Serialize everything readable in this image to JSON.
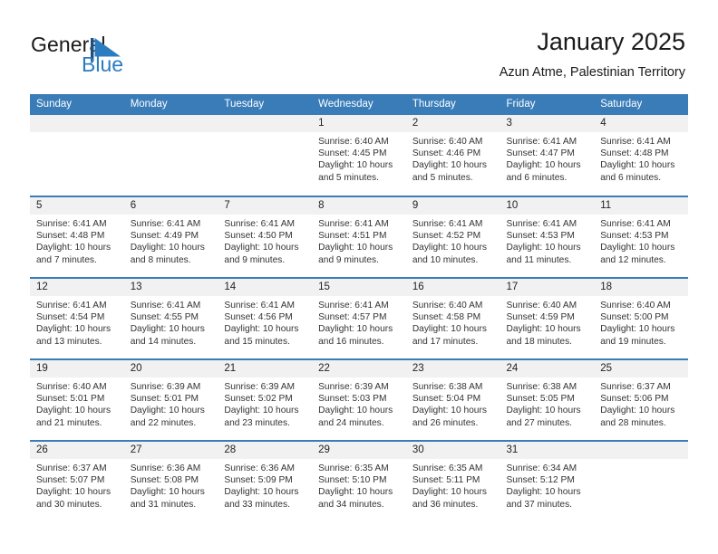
{
  "brand": {
    "name_part1": "General",
    "name_part2": "Blue",
    "logo_icon": "blue-triangle-flag-icon",
    "accent_color": "#2b7cc0"
  },
  "header": {
    "title": "January 2025",
    "subtitle": "Azun Atme, Palestinian Territory"
  },
  "theme": {
    "header_blue": "#3a7cb8",
    "band_gray": "#f1f1f1",
    "text_dark": "#1a1a1a"
  },
  "calendar": {
    "weekday_headers": [
      "Sunday",
      "Monday",
      "Tuesday",
      "Wednesday",
      "Thursday",
      "Friday",
      "Saturday"
    ],
    "weeks": [
      [
        {
          "day": "",
          "lines": []
        },
        {
          "day": "",
          "lines": []
        },
        {
          "day": "",
          "lines": []
        },
        {
          "day": "1",
          "lines": [
            "Sunrise: 6:40 AM",
            "Sunset: 4:45 PM",
            "Daylight: 10 hours",
            "and 5 minutes."
          ]
        },
        {
          "day": "2",
          "lines": [
            "Sunrise: 6:40 AM",
            "Sunset: 4:46 PM",
            "Daylight: 10 hours",
            "and 5 minutes."
          ]
        },
        {
          "day": "3",
          "lines": [
            "Sunrise: 6:41 AM",
            "Sunset: 4:47 PM",
            "Daylight: 10 hours",
            "and 6 minutes."
          ]
        },
        {
          "day": "4",
          "lines": [
            "Sunrise: 6:41 AM",
            "Sunset: 4:48 PM",
            "Daylight: 10 hours",
            "and 6 minutes."
          ]
        }
      ],
      [
        {
          "day": "5",
          "lines": [
            "Sunrise: 6:41 AM",
            "Sunset: 4:48 PM",
            "Daylight: 10 hours",
            "and 7 minutes."
          ]
        },
        {
          "day": "6",
          "lines": [
            "Sunrise: 6:41 AM",
            "Sunset: 4:49 PM",
            "Daylight: 10 hours",
            "and 8 minutes."
          ]
        },
        {
          "day": "7",
          "lines": [
            "Sunrise: 6:41 AM",
            "Sunset: 4:50 PM",
            "Daylight: 10 hours",
            "and 9 minutes."
          ]
        },
        {
          "day": "8",
          "lines": [
            "Sunrise: 6:41 AM",
            "Sunset: 4:51 PM",
            "Daylight: 10 hours",
            "and 9 minutes."
          ]
        },
        {
          "day": "9",
          "lines": [
            "Sunrise: 6:41 AM",
            "Sunset: 4:52 PM",
            "Daylight: 10 hours",
            "and 10 minutes."
          ]
        },
        {
          "day": "10",
          "lines": [
            "Sunrise: 6:41 AM",
            "Sunset: 4:53 PM",
            "Daylight: 10 hours",
            "and 11 minutes."
          ]
        },
        {
          "day": "11",
          "lines": [
            "Sunrise: 6:41 AM",
            "Sunset: 4:53 PM",
            "Daylight: 10 hours",
            "and 12 minutes."
          ]
        }
      ],
      [
        {
          "day": "12",
          "lines": [
            "Sunrise: 6:41 AM",
            "Sunset: 4:54 PM",
            "Daylight: 10 hours",
            "and 13 minutes."
          ]
        },
        {
          "day": "13",
          "lines": [
            "Sunrise: 6:41 AM",
            "Sunset: 4:55 PM",
            "Daylight: 10 hours",
            "and 14 minutes."
          ]
        },
        {
          "day": "14",
          "lines": [
            "Sunrise: 6:41 AM",
            "Sunset: 4:56 PM",
            "Daylight: 10 hours",
            "and 15 minutes."
          ]
        },
        {
          "day": "15",
          "lines": [
            "Sunrise: 6:41 AM",
            "Sunset: 4:57 PM",
            "Daylight: 10 hours",
            "and 16 minutes."
          ]
        },
        {
          "day": "16",
          "lines": [
            "Sunrise: 6:40 AM",
            "Sunset: 4:58 PM",
            "Daylight: 10 hours",
            "and 17 minutes."
          ]
        },
        {
          "day": "17",
          "lines": [
            "Sunrise: 6:40 AM",
            "Sunset: 4:59 PM",
            "Daylight: 10 hours",
            "and 18 minutes."
          ]
        },
        {
          "day": "18",
          "lines": [
            "Sunrise: 6:40 AM",
            "Sunset: 5:00 PM",
            "Daylight: 10 hours",
            "and 19 minutes."
          ]
        }
      ],
      [
        {
          "day": "19",
          "lines": [
            "Sunrise: 6:40 AM",
            "Sunset: 5:01 PM",
            "Daylight: 10 hours",
            "and 21 minutes."
          ]
        },
        {
          "day": "20",
          "lines": [
            "Sunrise: 6:39 AM",
            "Sunset: 5:01 PM",
            "Daylight: 10 hours",
            "and 22 minutes."
          ]
        },
        {
          "day": "21",
          "lines": [
            "Sunrise: 6:39 AM",
            "Sunset: 5:02 PM",
            "Daylight: 10 hours",
            "and 23 minutes."
          ]
        },
        {
          "day": "22",
          "lines": [
            "Sunrise: 6:39 AM",
            "Sunset: 5:03 PM",
            "Daylight: 10 hours",
            "and 24 minutes."
          ]
        },
        {
          "day": "23",
          "lines": [
            "Sunrise: 6:38 AM",
            "Sunset: 5:04 PM",
            "Daylight: 10 hours",
            "and 26 minutes."
          ]
        },
        {
          "day": "24",
          "lines": [
            "Sunrise: 6:38 AM",
            "Sunset: 5:05 PM",
            "Daylight: 10 hours",
            "and 27 minutes."
          ]
        },
        {
          "day": "25",
          "lines": [
            "Sunrise: 6:37 AM",
            "Sunset: 5:06 PM",
            "Daylight: 10 hours",
            "and 28 minutes."
          ]
        }
      ],
      [
        {
          "day": "26",
          "lines": [
            "Sunrise: 6:37 AM",
            "Sunset: 5:07 PM",
            "Daylight: 10 hours",
            "and 30 minutes."
          ]
        },
        {
          "day": "27",
          "lines": [
            "Sunrise: 6:36 AM",
            "Sunset: 5:08 PM",
            "Daylight: 10 hours",
            "and 31 minutes."
          ]
        },
        {
          "day": "28",
          "lines": [
            "Sunrise: 6:36 AM",
            "Sunset: 5:09 PM",
            "Daylight: 10 hours",
            "and 33 minutes."
          ]
        },
        {
          "day": "29",
          "lines": [
            "Sunrise: 6:35 AM",
            "Sunset: 5:10 PM",
            "Daylight: 10 hours",
            "and 34 minutes."
          ]
        },
        {
          "day": "30",
          "lines": [
            "Sunrise: 6:35 AM",
            "Sunset: 5:11 PM",
            "Daylight: 10 hours",
            "and 36 minutes."
          ]
        },
        {
          "day": "31",
          "lines": [
            "Sunrise: 6:34 AM",
            "Sunset: 5:12 PM",
            "Daylight: 10 hours",
            "and 37 minutes."
          ]
        },
        {
          "day": "",
          "lines": []
        }
      ]
    ]
  }
}
